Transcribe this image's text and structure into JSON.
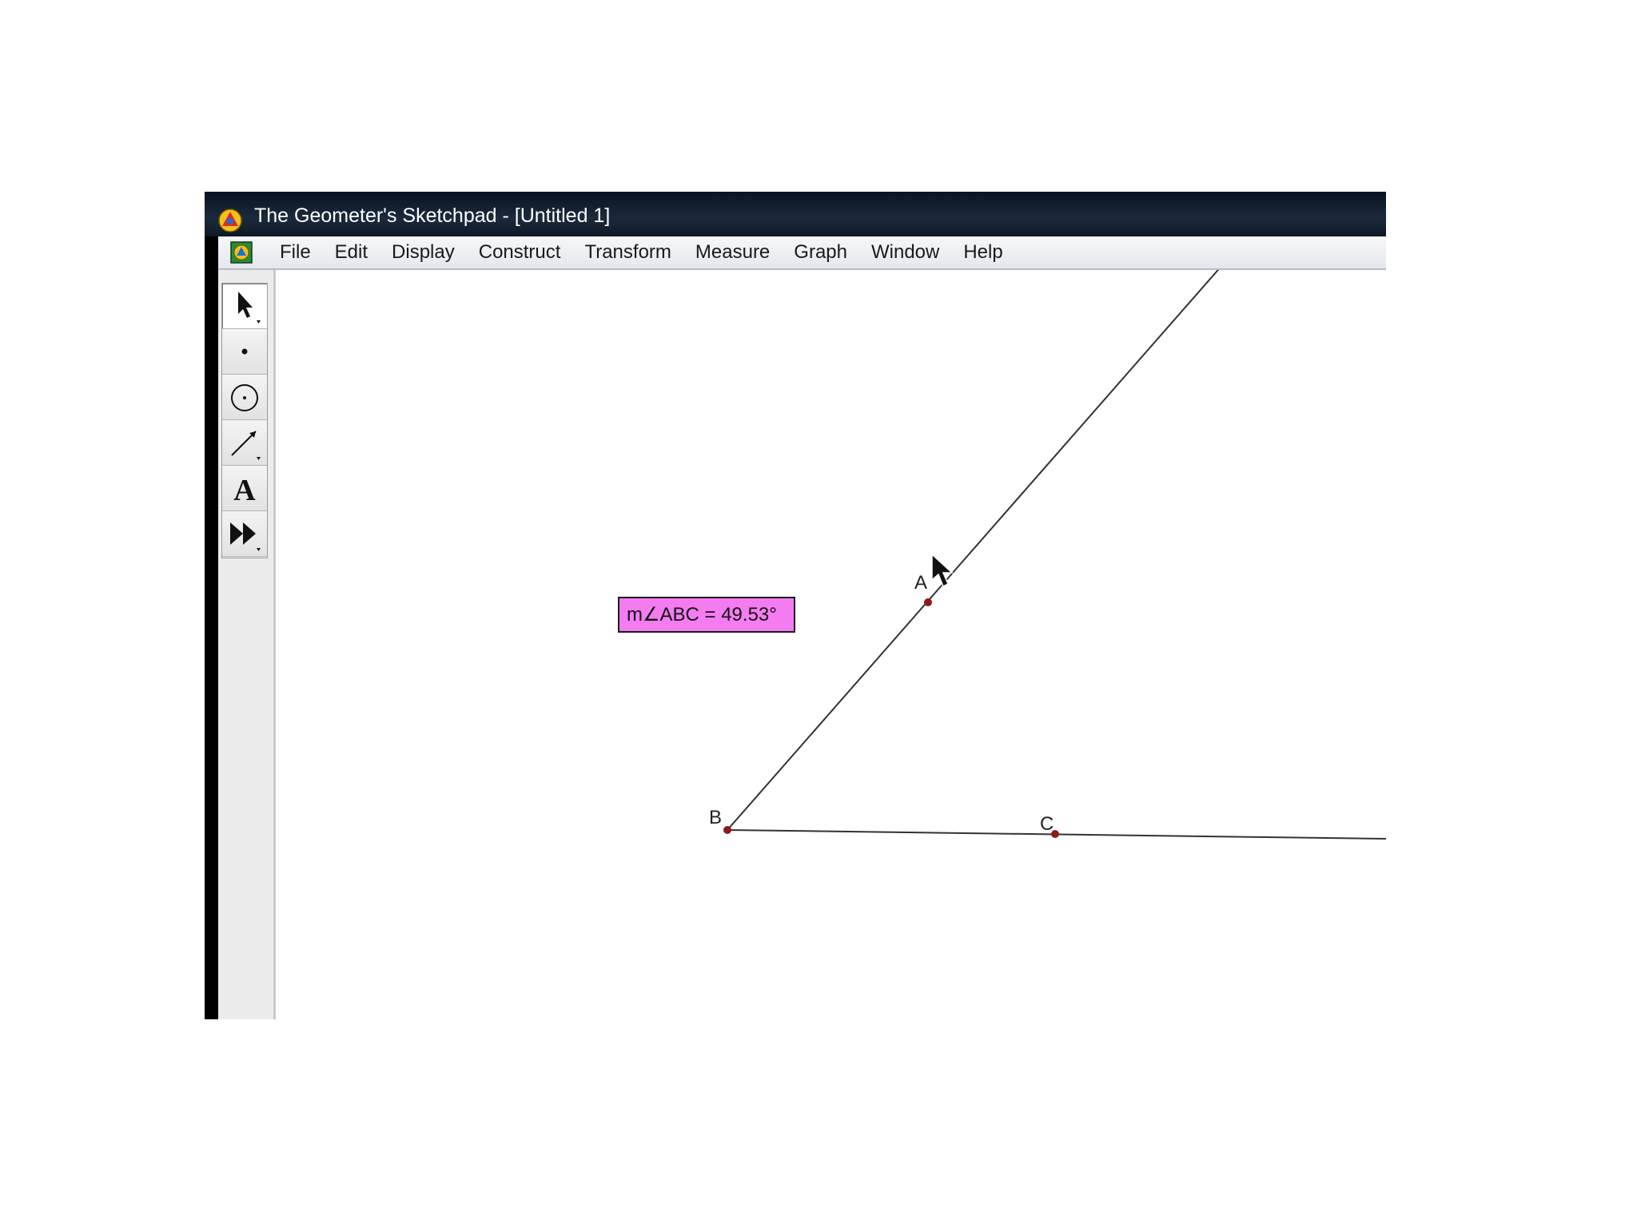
{
  "window": {
    "title": "The Geometer's Sketchpad - [Untitled 1]",
    "app_icon": "sketchpad-logo-icon",
    "document_icon": "sketchpad-document-icon"
  },
  "menu": {
    "items": [
      "File",
      "Edit",
      "Display",
      "Construct",
      "Transform",
      "Measure",
      "Graph",
      "Window",
      "Help"
    ]
  },
  "toolbox": {
    "tools": [
      {
        "name": "selection-arrow-tool",
        "icon": "arrow-icon",
        "selected": true
      },
      {
        "name": "point-tool",
        "icon": "point-icon",
        "selected": false
      },
      {
        "name": "compass-tool",
        "icon": "circle-icon",
        "selected": false
      },
      {
        "name": "straightedge-tool",
        "icon": "segment-icon",
        "selected": false
      },
      {
        "name": "text-tool",
        "icon": "letter-a-icon",
        "selected": false
      },
      {
        "name": "custom-tool",
        "icon": "fast-forward-icon",
        "selected": false
      }
    ]
  },
  "sketch": {
    "measurement": "m∠ABC = 49.53°",
    "measurement_color": "#f47cf1",
    "point_color": "#8b1a1a",
    "line_color": "#333333",
    "points": [
      {
        "label": "A"
      },
      {
        "label": "B"
      },
      {
        "label": "C"
      }
    ]
  }
}
